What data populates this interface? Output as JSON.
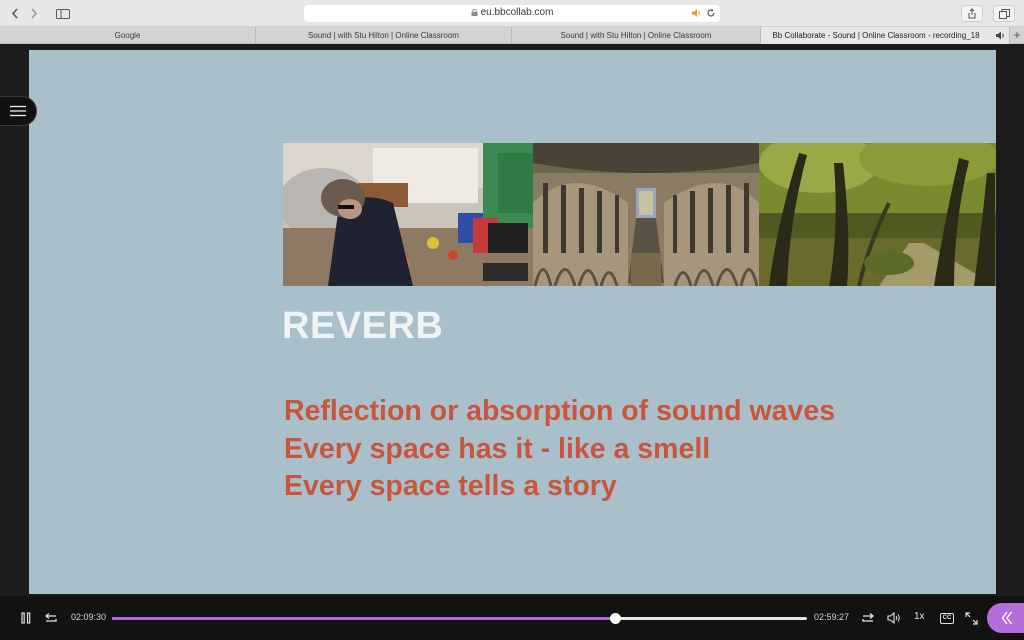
{
  "browser": {
    "url": "eu.bbcollab.com",
    "tabs": [
      {
        "label": "Google"
      },
      {
        "label": "Sound | with Stu Hilton | Online Classroom"
      },
      {
        "label": "Sound | with Stu Hilton | Online Classroom"
      },
      {
        "label": "Bb Collaborate - Sound | Online Classroom - recording_18"
      }
    ],
    "new_tab_label": "+"
  },
  "slide": {
    "title": "REVERB",
    "bullets": [
      "Reflection or absorption of sound waves",
      "Every space has it - like a smell",
      "Every space tells a story"
    ],
    "photos": [
      "messy-room-photo",
      "cathedral-nave-photo",
      "forest-path-photo"
    ]
  },
  "player": {
    "elapsed": "02:09:30",
    "duration": "02:59:27",
    "progress_fraction": 0.724,
    "speed": "1x",
    "cc_label": "CC",
    "accent_color": "#b06ad8"
  },
  "colors": {
    "slide_background": "#a9bfca",
    "bullet_text": "#c8553c",
    "title_text": "#eef3f5"
  }
}
